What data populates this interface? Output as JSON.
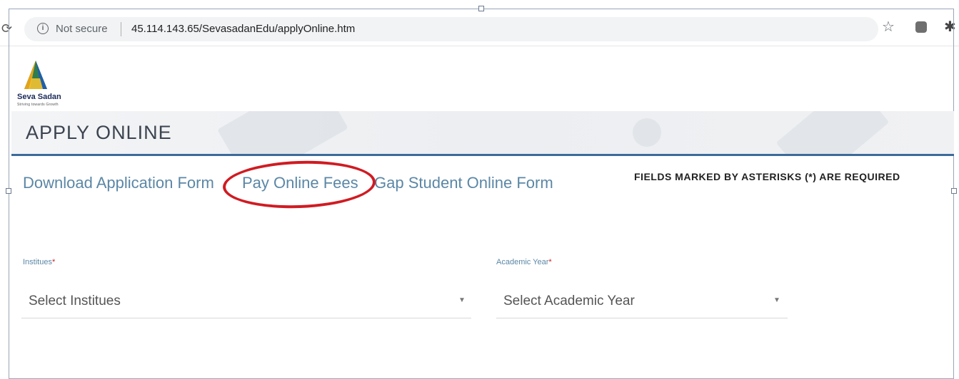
{
  "browser": {
    "security_label": "Not secure",
    "url": "45.114.143.65/SevasadanEdu/applyOnline.htm",
    "icons": [
      "reload-icon",
      "info-icon",
      "star-icon",
      "extension-icon",
      "puzzle-icon"
    ]
  },
  "logo": {
    "name": "Seva Sadan",
    "tagline": "Striving towards Growth"
  },
  "page": {
    "title": "APPLY ONLINE"
  },
  "links": [
    {
      "label": "Download Application Form"
    },
    {
      "label": "Pay Online Fees"
    },
    {
      "label": "Gap Student Online Form"
    }
  ],
  "required_note": "FIELDS MARKED BY ASTERISKS (*) ARE REQUIRED",
  "form": {
    "institutes": {
      "label": "Institues",
      "required_mark": "*",
      "value": "Select Institues"
    },
    "academic_year": {
      "label": "Academic Year",
      "required_mark": "*",
      "value": "Select Academic Year"
    }
  },
  "colors": {
    "accent_blue": "#3b6b9b",
    "link_blue": "#5b87a6",
    "annotation_red": "#d01b22"
  }
}
